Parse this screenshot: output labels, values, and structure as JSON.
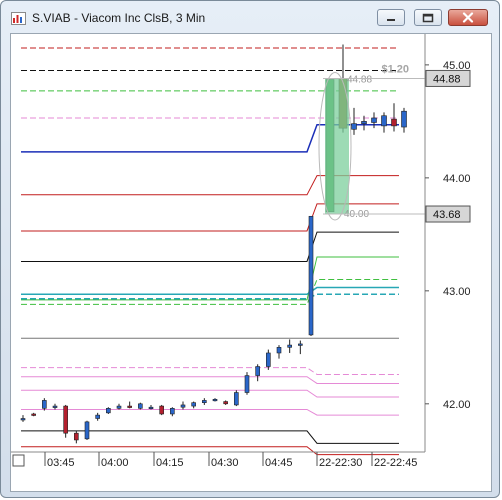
{
  "window": {
    "title": "S.VIAB - Viacom Inc ClsB, 3 Min"
  },
  "colors": {
    "up": "#2a66c9",
    "down": "#b3202e",
    "level_blue": "#1b2fb8",
    "cyan": "#27a7b5",
    "highlight": "#7ccf9c"
  },
  "icons": {
    "app": "chart-app-icon",
    "minimize": "minimize-icon",
    "maximize": "maximize-icon",
    "close": "close-icon",
    "corner": "corner-box-icon"
  },
  "chart_data": {
    "type": "candlestick",
    "y_axis": {
      "range": [
        41.6,
        45.3
      ],
      "ticks": [
        "45.00",
        "44.00",
        "43.00",
        "42.00"
      ]
    },
    "x_axis": {
      "ticks": [
        "03:45",
        "04:00",
        "04:15",
        "04:30",
        "04:45",
        "22-22:30",
        "22-22:45"
      ]
    },
    "price_tags": [
      {
        "label": "44.88",
        "value": 44.88
      },
      {
        "label": "43.68",
        "value": 43.68
      }
    ],
    "annotations": [
      {
        "label": "$1.20"
      },
      {
        "label": "44.88",
        "value": 44.88
      },
      {
        "label": "40.00",
        "value": 43.68
      }
    ],
    "candles_early": [
      [
        41.86,
        41.9,
        41.84,
        41.87
      ],
      [
        41.91,
        41.92,
        41.89,
        41.9
      ],
      [
        41.96,
        42.05,
        41.94,
        42.03
      ],
      [
        41.97,
        42.0,
        41.95,
        41.98
      ],
      [
        41.98,
        41.99,
        41.7,
        41.74
      ],
      [
        41.74,
        41.76,
        41.65,
        41.68
      ],
      [
        41.69,
        41.85,
        41.68,
        41.84
      ],
      [
        41.87,
        41.92,
        41.85,
        41.9
      ],
      [
        41.92,
        41.97,
        41.91,
        41.96
      ],
      [
        41.96,
        42.0,
        41.95,
        41.98
      ],
      [
        41.98,
        42.02,
        41.96,
        41.97
      ],
      [
        41.96,
        42.01,
        41.95,
        42.0
      ],
      [
        41.97,
        41.99,
        41.95,
        41.97
      ],
      [
        41.98,
        41.99,
        41.9,
        41.91
      ],
      [
        41.91,
        41.97,
        41.89,
        41.96
      ],
      [
        41.97,
        42.02,
        41.95,
        41.99
      ],
      [
        41.98,
        42.02,
        41.96,
        42.01
      ],
      [
        42.01,
        42.05,
        41.99,
        42.03
      ],
      [
        42.03,
        42.05,
        42.02,
        42.04
      ],
      [
        42.02,
        42.03,
        41.99,
        42.0
      ],
      [
        41.99,
        42.12,
        41.98,
        42.1
      ],
      [
        42.1,
        42.28,
        42.08,
        42.25
      ],
      [
        42.25,
        42.35,
        42.2,
        42.33
      ],
      [
        42.33,
        42.48,
        42.3,
        42.45
      ],
      [
        42.45,
        42.52,
        42.4,
        42.5
      ],
      [
        42.5,
        42.57,
        42.45,
        42.52
      ],
      [
        42.52,
        42.56,
        42.44,
        42.53
      ],
      [
        42.61,
        43.66,
        42.6,
        43.66
      ]
    ],
    "candles_late": [
      [
        43.7,
        44.9,
        43.66,
        44.87
      ],
      [
        44.88,
        45.18,
        44.4,
        44.44
      ],
      [
        44.43,
        44.62,
        44.38,
        44.48
      ],
      [
        44.48,
        44.55,
        44.42,
        44.5
      ],
      [
        44.49,
        44.58,
        44.44,
        44.53
      ],
      [
        44.46,
        44.58,
        44.4,
        44.55
      ],
      [
        44.52,
        44.66,
        44.41,
        44.46
      ],
      [
        44.45,
        44.62,
        44.4,
        44.59
      ]
    ],
    "level_lines": [
      {
        "value": 45.15,
        "color": "#c21d1d",
        "dash": true
      },
      {
        "value": 44.95,
        "color": "#111111",
        "dash": true
      },
      {
        "value": 44.77,
        "color": "#3fbf3f",
        "dash": true
      },
      {
        "value": 44.53,
        "color": "#e58ad6",
        "dash": true
      },
      {
        "value": 44.23,
        "color": "#1b2fb8",
        "dash": false,
        "late": 44.47
      },
      {
        "value": 43.85,
        "color": "#c21d1d",
        "dash": false,
        "late": 44.02
      },
      {
        "value": 43.53,
        "color": "#c21d1d",
        "dash": false,
        "late": 43.77
      },
      {
        "value": 43.26,
        "color": "#111111",
        "dash": false,
        "late": 43.52
      },
      {
        "value": 42.92,
        "color": "#3fbf3f",
        "dash": false,
        "late": 43.3
      },
      {
        "value": 42.88,
        "color": "#3fbf3f",
        "dash": true,
        "late": 43.1
      },
      {
        "value": 42.97,
        "color": "#27a7b5",
        "dash": false,
        "late": 43.03
      },
      {
        "value": 42.93,
        "color": "#27a7b5",
        "dash": true,
        "late": 42.97
      },
      {
        "value": 42.58,
        "color": "#777777",
        "dash": false,
        "late": 42.58
      },
      {
        "value": 42.32,
        "color": "#e58ad6",
        "dash": true,
        "late": 42.26
      },
      {
        "value": 42.24,
        "color": "#e58ad6",
        "dash": false,
        "late": 42.18
      },
      {
        "value": 42.12,
        "color": "#e58ad6",
        "dash": false,
        "late": 42.06
      },
      {
        "value": 41.95,
        "color": "#e58ad6",
        "dash": false,
        "late": 41.9
      },
      {
        "value": 41.76,
        "color": "#111111",
        "dash": false,
        "late": 41.65
      },
      {
        "value": 41.62,
        "color": "#c21d1d",
        "dash": false,
        "late": 41.55
      }
    ]
  }
}
